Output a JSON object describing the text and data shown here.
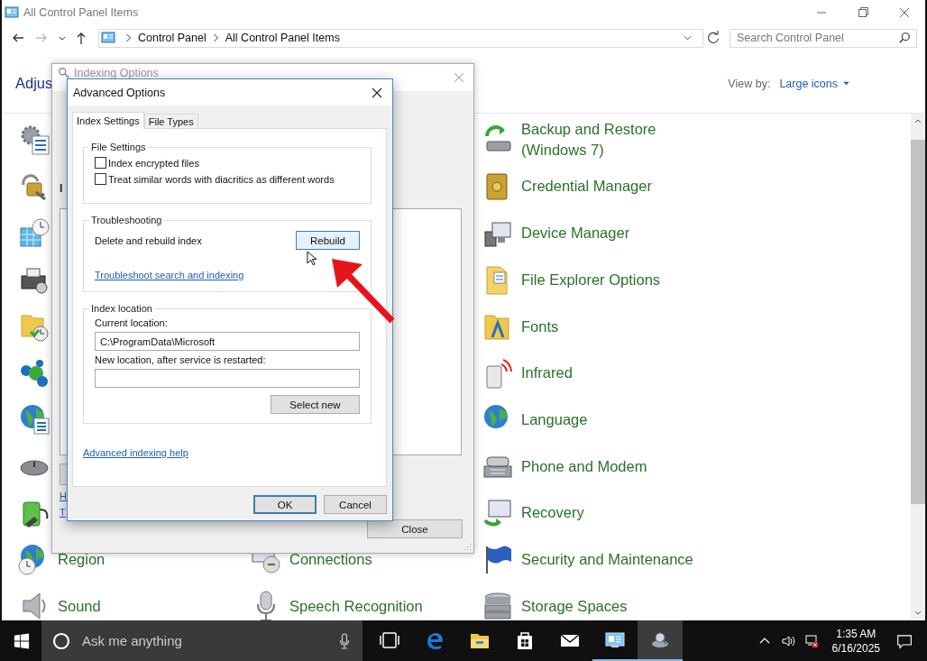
{
  "window": {
    "title": "All Control Panel Items"
  },
  "address_bar": {
    "breadcrumbs": [
      "Control Panel",
      "All Control Panel Items"
    ]
  },
  "search": {
    "placeholder": "Search Control Panel"
  },
  "header": {
    "title": "Adjus",
    "view_by_label": "View by:",
    "view_by_value": "Large icons"
  },
  "columns": [
    {
      "items": [
        {
          "label": "Region"
        },
        {
          "label": "Sound"
        }
      ]
    },
    {
      "items": [
        {
          "label": "Connections"
        },
        {
          "label": "Speech Recognition"
        }
      ]
    },
    {
      "items": [
        {
          "label": "Backup and Restore (Windows 7)"
        },
        {
          "label": "Credential Manager"
        },
        {
          "label": "Device Manager"
        },
        {
          "label": "File Explorer Options"
        },
        {
          "label": "Fonts"
        },
        {
          "label": "Infrared"
        },
        {
          "label": "Language"
        },
        {
          "label": "Phone and Modem"
        },
        {
          "label": "Recovery"
        },
        {
          "label": "Security and Maintenance"
        },
        {
          "label": "Storage Spaces"
        }
      ]
    }
  ],
  "indexing_window": {
    "title": "Indexing Options",
    "label_fragment": "I",
    "link_fragments": [
      "H",
      "T"
    ],
    "close_button": "Close"
  },
  "advanced_dialog": {
    "title": "Advanced Options",
    "tabs": [
      {
        "label": "Index Settings",
        "selected": true
      },
      {
        "label": "File Types",
        "selected": false
      }
    ],
    "file_settings": {
      "title": "File Settings",
      "checkboxes": [
        {
          "label": "Index encrypted files",
          "checked": false
        },
        {
          "label": "Treat similar words with diacritics as different words",
          "checked": false
        }
      ]
    },
    "troubleshooting": {
      "title": "Troubleshooting",
      "rebuild_label": "Delete and rebuild index",
      "rebuild_button": {
        "label": "Rebuild",
        "hovered": true
      },
      "link": "Troubleshoot search and indexing"
    },
    "index_location": {
      "title": "Index location",
      "current_label": "Current location:",
      "current_value": "C:\\ProgramData\\Microsoft",
      "new_label": "New location, after service is restarted:",
      "select_button": "Select new"
    },
    "help_link": "Advanced indexing help",
    "buttons": [
      {
        "label": "OK",
        "default": true
      },
      {
        "label": "Cancel",
        "default": false
      }
    ]
  },
  "taskbar": {
    "search_placeholder": "Ask me anything",
    "apps": [
      {
        "kind": "task-view",
        "active": false,
        "focused": false
      },
      {
        "kind": "edge",
        "active": false,
        "focused": false
      },
      {
        "kind": "file-explorer",
        "active": false,
        "focused": false
      },
      {
        "kind": "store",
        "active": false,
        "focused": false
      },
      {
        "kind": "mail",
        "active": false,
        "focused": false
      },
      {
        "kind": "control-panel",
        "active": true,
        "focused": false
      },
      {
        "kind": "indexing",
        "active": true,
        "focused": true
      }
    ],
    "time": "1:35 AM",
    "date": "6/16/2025"
  }
}
